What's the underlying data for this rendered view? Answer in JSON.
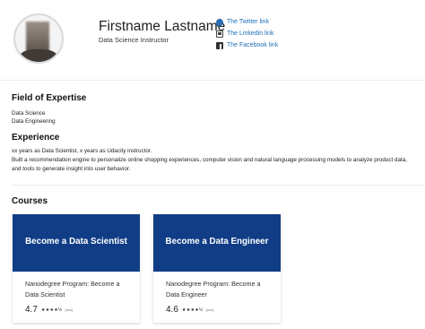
{
  "profile": {
    "name": "Firstname Lastname",
    "title": "Data Science Instructor"
  },
  "social": {
    "twitter": "The Twitter link",
    "linkedin": "The Linkedin link",
    "facebook": "The Facebook link"
  },
  "expertise": {
    "heading": "Field of Expertise",
    "items": [
      "Data Science",
      "Data Engineering"
    ]
  },
  "experience": {
    "heading": "Experience",
    "lines": [
      "xx years as Data Scientist, x years as Udacity instructor.",
      "Built a recommendation engine to personalize online shopping experiences, computer vision and natural language processing models to analyze product data,",
      "and tools to generate insight into user behavior."
    ]
  },
  "courses": {
    "heading": "Courses",
    "items": [
      {
        "banner": "Become a Data Scientist",
        "title": "Nanodegree Program: Become a Data Scientist",
        "rating": "4.7",
        "stars": "★★★★½",
        "count": "(xxx)"
      },
      {
        "banner": "Become a Data Engineer",
        "title": "Nanodegree Program: Become a Data Engineer",
        "rating": "4.6",
        "stars": "★★★★½",
        "count": "(xxx)"
      }
    ]
  },
  "colors": {
    "banner": "#103d86",
    "link": "#1f6fb5"
  }
}
